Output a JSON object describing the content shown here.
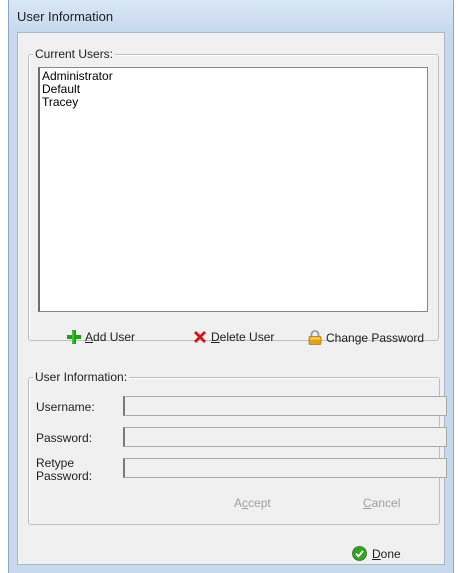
{
  "window": {
    "title": "User Information"
  },
  "current_users": {
    "legend": "Current Users:",
    "items": [
      "Administrator",
      "Default",
      "Tracey"
    ]
  },
  "actions": {
    "add_user": {
      "mnemonic": "A",
      "rest": "dd User",
      "icon": "plus-icon",
      "color": "#1aa31a"
    },
    "delete_user": {
      "mnemonic": "D",
      "rest": "elete User",
      "icon": "red-x-icon",
      "color": "#d4161b"
    },
    "change_password": {
      "label": "Change Password",
      "icon": "padlock-icon",
      "color": "#e0a21c"
    }
  },
  "user_information": {
    "legend": "User Information:",
    "username_label": "Username:",
    "password_label": "Password:",
    "retype_label_line1": "Retype",
    "retype_label_line2": "Password:",
    "username_value": "",
    "password_value": "",
    "retype_value": "",
    "accept": {
      "before": "A",
      "mnemonic": "c",
      "after": "cept"
    },
    "cancel": {
      "mnemonic": "C",
      "rest": "ancel"
    }
  },
  "done": {
    "mnemonic": "D",
    "rest": "one",
    "icon": "green-check-icon",
    "color": "#3aa02a"
  }
}
